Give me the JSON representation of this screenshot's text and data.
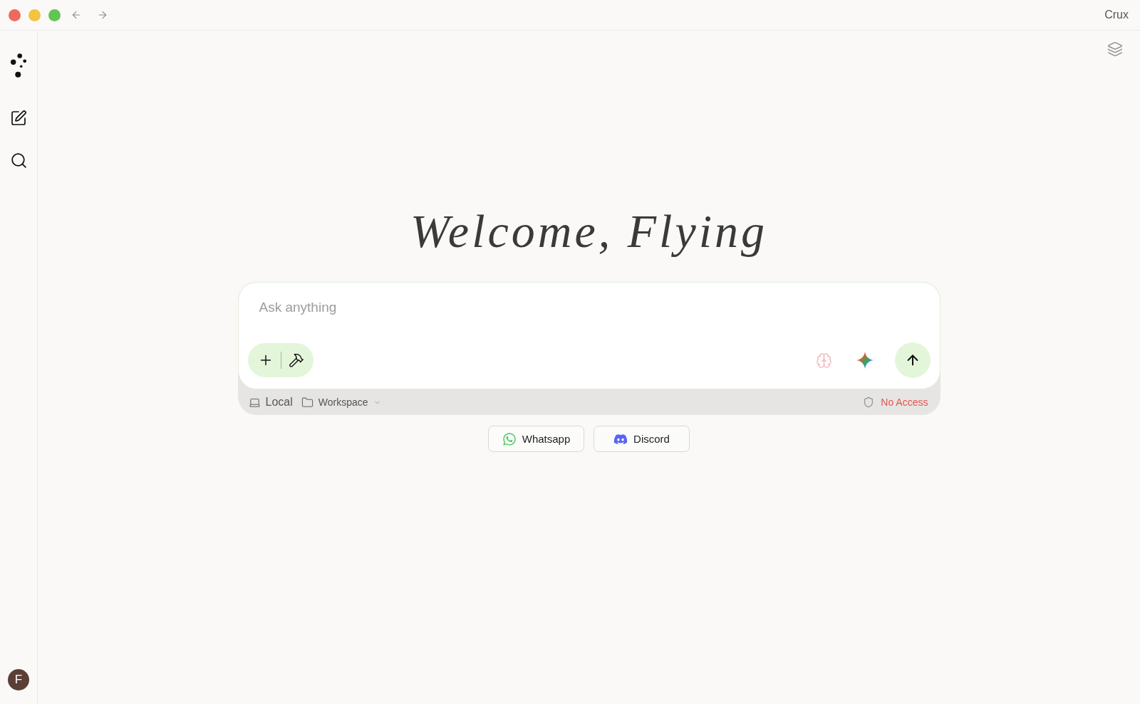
{
  "window": {
    "title": "Crux"
  },
  "sidebar": {
    "avatar": {
      "initial": "F"
    }
  },
  "greeting": "Welcome, Flying",
  "composer": {
    "placeholder": "Ask anything",
    "location": "Local",
    "folder": "Workspace",
    "access": "No Access"
  },
  "shortcuts": [
    {
      "label": "Whatsapp",
      "kind": "whatsapp"
    },
    {
      "label": "Discord",
      "kind": "discord"
    }
  ]
}
